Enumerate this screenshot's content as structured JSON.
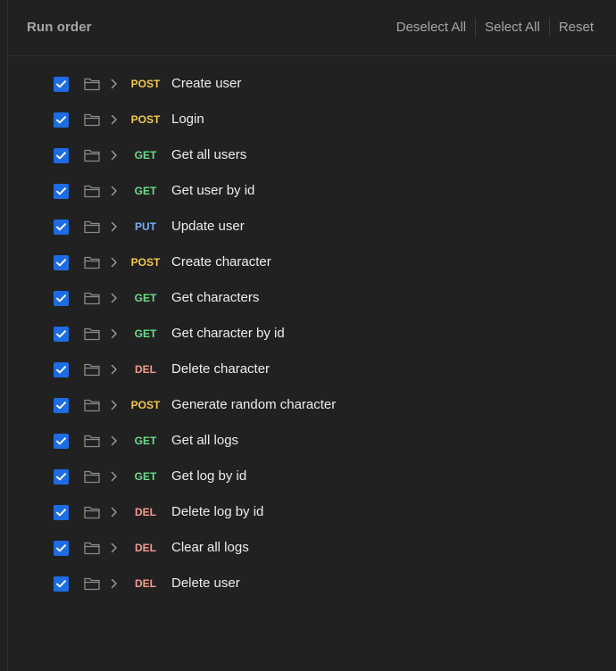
{
  "header": {
    "title": "Run order",
    "deselect_all": "Deselect All",
    "select_all": "Select All",
    "reset": "Reset"
  },
  "colors": {
    "POST": "#f2c94c",
    "GET": "#6bdd8b",
    "PUT": "#74aef6",
    "DEL": "#f79a8e",
    "checkbox": "#1e6ce3"
  },
  "requests": [
    {
      "method": "POST",
      "name": "Create user",
      "checked": true
    },
    {
      "method": "POST",
      "name": "Login",
      "checked": true
    },
    {
      "method": "GET",
      "name": "Get all users",
      "checked": true
    },
    {
      "method": "GET",
      "name": "Get user by id",
      "checked": true
    },
    {
      "method": "PUT",
      "name": "Update user",
      "checked": true
    },
    {
      "method": "POST",
      "name": "Create character",
      "checked": true
    },
    {
      "method": "GET",
      "name": "Get characters",
      "checked": true
    },
    {
      "method": "GET",
      "name": "Get character by id",
      "checked": true
    },
    {
      "method": "DEL",
      "name": "Delete character",
      "checked": true
    },
    {
      "method": "POST",
      "name": "Generate random character",
      "checked": true
    },
    {
      "method": "GET",
      "name": "Get all logs",
      "checked": true
    },
    {
      "method": "GET",
      "name": "Get log by id",
      "checked": true
    },
    {
      "method": "DEL",
      "name": "Delete log by id",
      "checked": true
    },
    {
      "method": "DEL",
      "name": "Clear all logs",
      "checked": true
    },
    {
      "method": "DEL",
      "name": "Delete user",
      "checked": true
    }
  ]
}
